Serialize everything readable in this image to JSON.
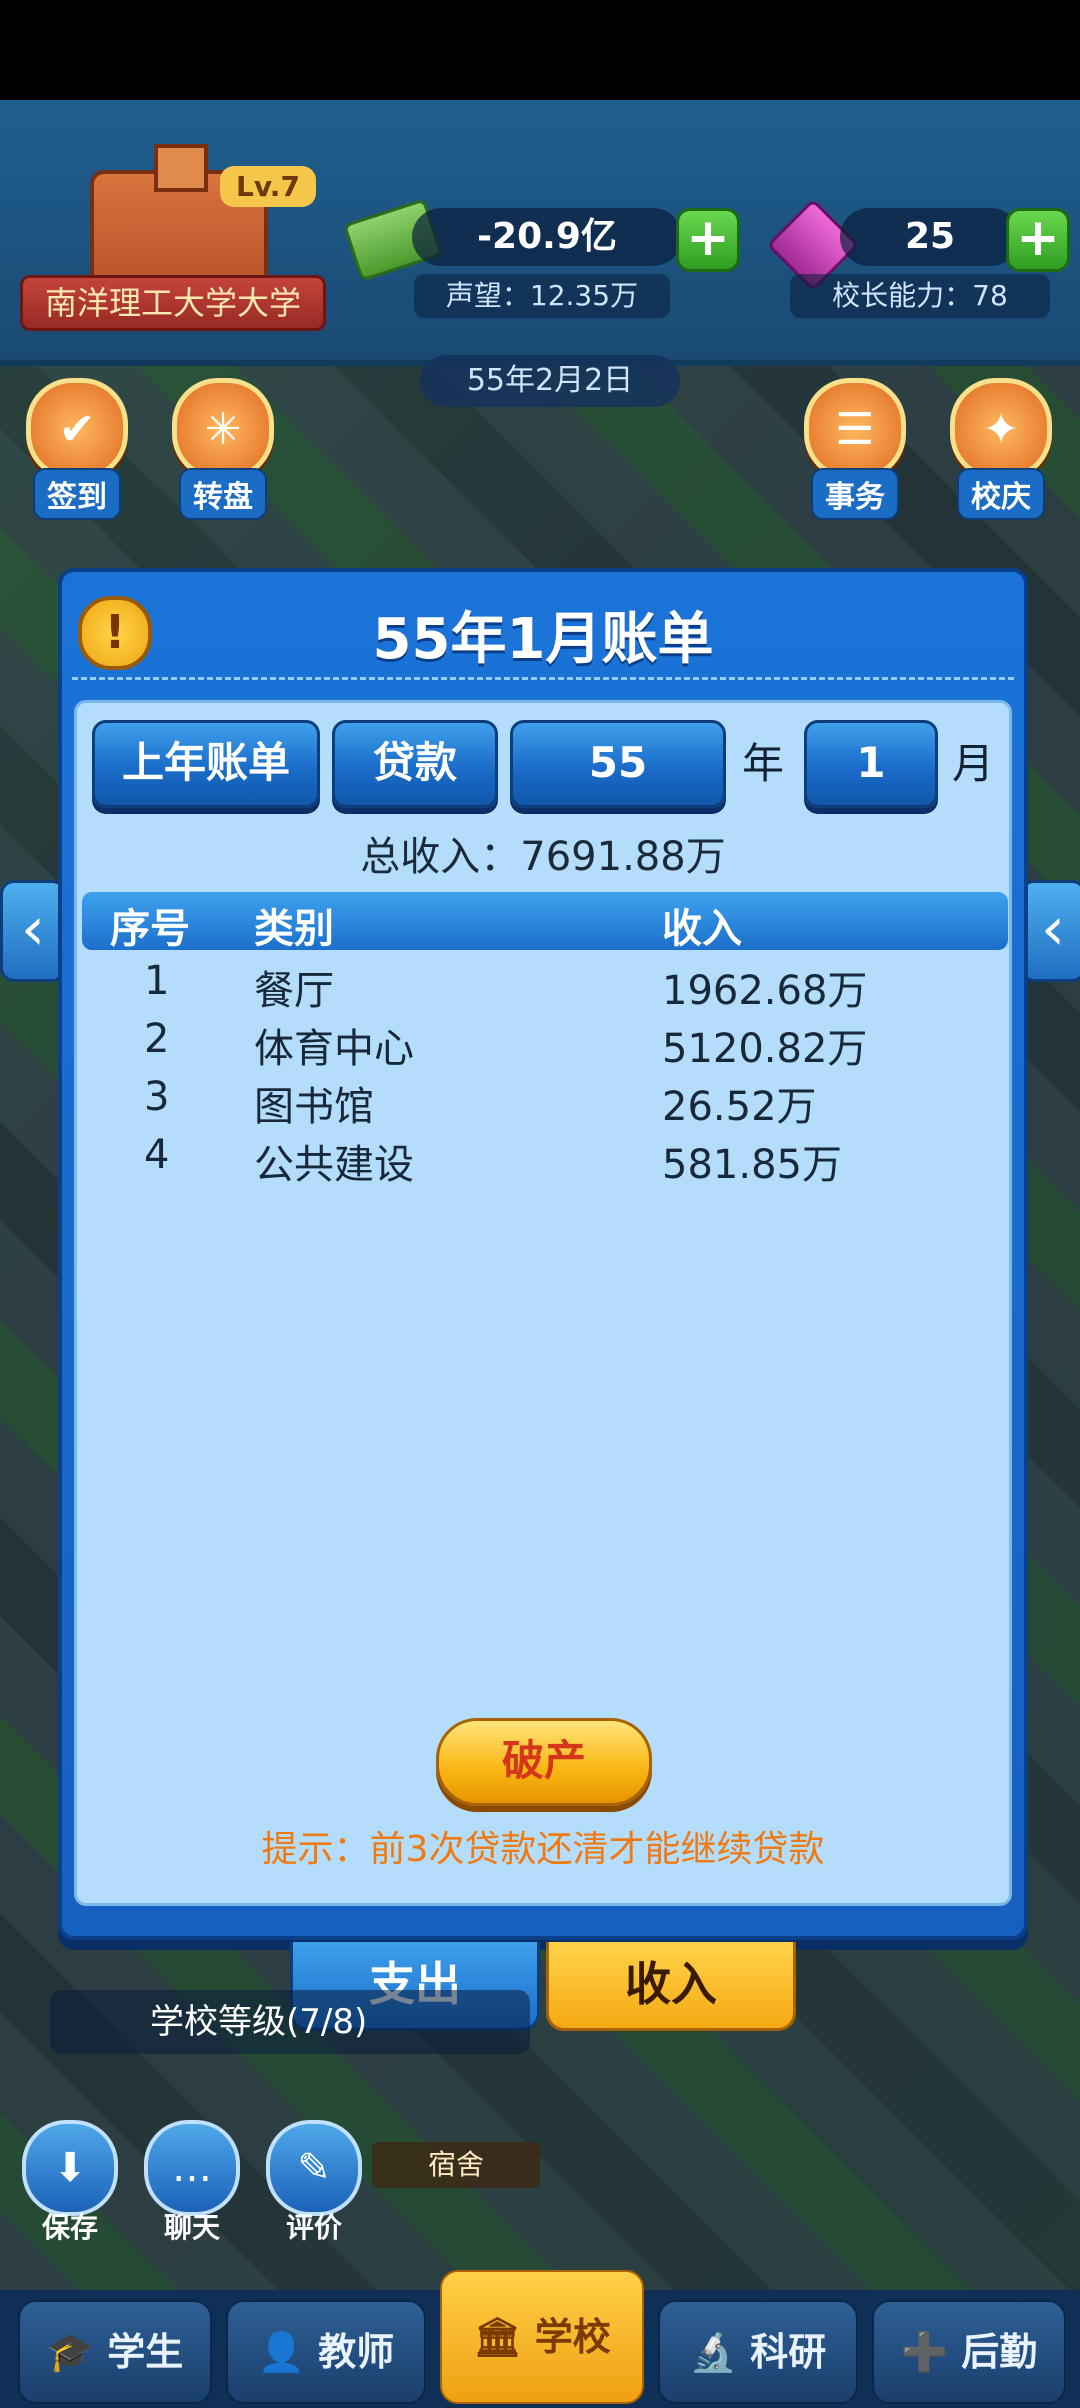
{
  "header": {
    "school_name": "南洋理工大学大学",
    "level": "Lv.7",
    "money": "-20.9亿",
    "gems": "25",
    "reputation": "声望：12.35万",
    "principal_ability": "校长能力：78",
    "date": "55年2月2日"
  },
  "side_buttons": {
    "checkin": "签到",
    "wheel": "转盘",
    "affairs": "事务",
    "anniversary": "校庆"
  },
  "modal": {
    "title": "55年1月账单",
    "prev_year_bill": "上年账单",
    "loan": "贷款",
    "year_value": "55",
    "year_unit": "年",
    "month_value": "1",
    "month_unit": "月",
    "total_income": "总收入：7691.88万",
    "columns": [
      "序号",
      "类别",
      "收入"
    ],
    "rows": [
      {
        "no": "1",
        "category": "餐厅",
        "income": "1962.68万"
      },
      {
        "no": "2",
        "category": "体育中心",
        "income": "5120.82万"
      },
      {
        "no": "3",
        "category": "图书馆",
        "income": "26.52万"
      },
      {
        "no": "4",
        "category": "公共建设",
        "income": "581.85万"
      }
    ],
    "bankrupt_button": "破产",
    "hint": "提示：前3次贷款还清才能继续贷款"
  },
  "tabs": {
    "expense": "支出",
    "income": "收入"
  },
  "background_labels": {
    "school_level": "学校等级(7/8)",
    "dormitory": "宿舍",
    "save": "保存",
    "chat": "聊天",
    "review": "评价"
  },
  "bottom_nav": [
    {
      "label": "学生",
      "icon": "graduation-cap-icon"
    },
    {
      "label": "教师",
      "icon": "teacher-icon"
    },
    {
      "label": "学校",
      "icon": "school-icon"
    },
    {
      "label": "科研",
      "icon": "microscope-icon"
    },
    {
      "label": "后勤",
      "icon": "logistics-icon"
    }
  ],
  "colors": {
    "modal_blue": "#1b73d8",
    "modal_body": "#b4ddfb",
    "button_yellow": "#f9b612",
    "hint_orange": "#f07a12",
    "bankrupt_red": "#d5361a"
  }
}
